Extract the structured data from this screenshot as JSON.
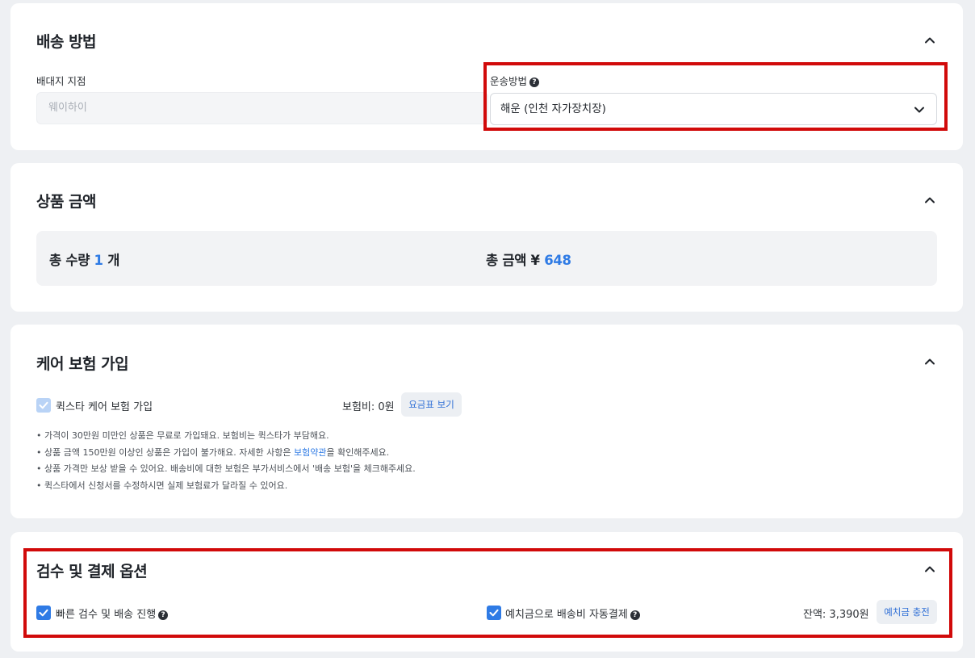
{
  "shipping": {
    "title": "배송 방법",
    "warehouse_label": "배대지 지점",
    "warehouse_value": "웨이하이",
    "method_label": "운송방법",
    "method_value": "해운 (인천 자가장치장)"
  },
  "product": {
    "title": "상품 금액",
    "qty_label": "총 수량",
    "qty_value": "1",
    "qty_unit": "개",
    "amount_label": "총 금액",
    "currency": "¥",
    "amount_value": "648"
  },
  "insurance": {
    "title": "케어 보험 가입",
    "checkbox_label": "퀵스타 케어 보험 가입",
    "fee_text": "보험비: 0원",
    "fee_table_button": "요금표 보기",
    "notes": [
      "가격이 30만원 미만인 상품은 무료로 가입돼요. 보험비는 퀵스타가 부담해요.",
      "상품 금액 150만원 이상인 상품은 가입이 불가해요. 자세한 사항은 ",
      "상품 가격만 보상 받을 수 있어요. 배송비에 대한 보험은 부가서비스에서 '배송 보험'을 체크해주세요.",
      "퀵스타에서 신청서를 수정하시면 실제 보험료가 달라질 수 있어요."
    ],
    "note2_link": "보험약관",
    "note2_suffix": "을 확인해주세요."
  },
  "inspection": {
    "title": "검수 및 결제 옵션",
    "fast_label": "빠른 검수 및 배송 진행",
    "deposit_label": "예치금으로 배송비 자동결제",
    "balance_text": "잔액: 3,390원",
    "charge_button": "예치금 충전"
  },
  "colors": {
    "accent": "#2f7be5",
    "highlight": "#d10a0a",
    "background": "#eef0f3"
  },
  "icons": {
    "collapse": "chevron-up-icon",
    "dropdown": "chevron-down-icon",
    "help": "question-circle-icon",
    "check": "check-icon"
  }
}
